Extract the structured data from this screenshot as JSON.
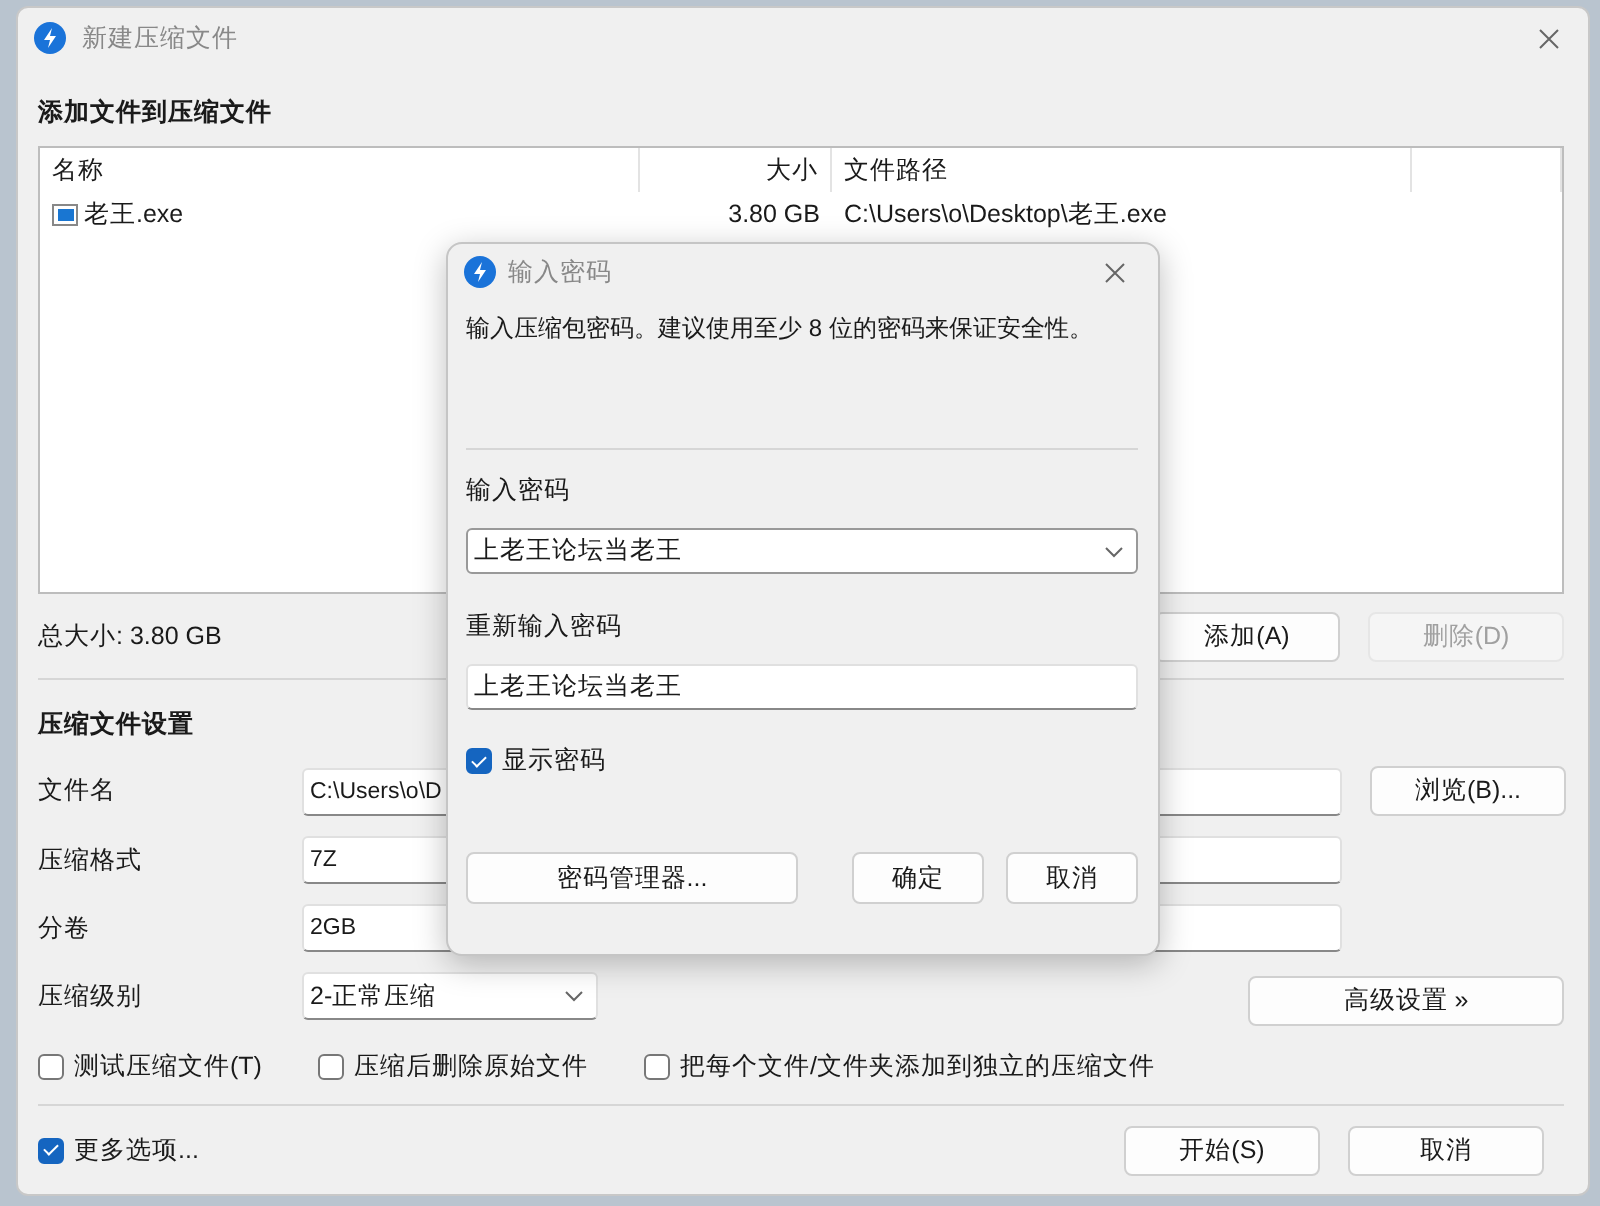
{
  "window": {
    "title": "新建压缩文件"
  },
  "files_section": {
    "heading": "添加文件到压缩文件",
    "columns": [
      "名称",
      "大小",
      "文件路径"
    ],
    "rows": [
      {
        "name": "老王.exe",
        "size": "3.80 GB",
        "path": "C:\\Users\\o\\Desktop\\老王.exe"
      }
    ],
    "total": "总大小: 3.80 GB",
    "buttons": [
      {
        "label": "添加(A)",
        "disabled": false
      },
      {
        "label": "删除(D)",
        "disabled": true
      }
    ]
  },
  "settings": {
    "heading": "压缩文件设置",
    "fields": [
      {
        "label": "文件名",
        "value": "C:\\Users\\o\\D",
        "kind": "text"
      },
      {
        "label": "压缩格式",
        "value": "7Z",
        "kind": "text"
      },
      {
        "label": "分卷",
        "value": "2GB",
        "kind": "text"
      },
      {
        "label": "压缩级别",
        "value": "2-正常压缩",
        "kind": "dropdown"
      }
    ],
    "browse_button": "浏览(B)...",
    "advanced_button": "高级设置 »",
    "options": [
      {
        "label": "测试压缩文件(T)",
        "checked": false
      },
      {
        "label": "压缩后删除原始文件",
        "checked": false
      },
      {
        "label": "把每个文件/文件夹添加到独立的压缩文件",
        "checked": false
      }
    ]
  },
  "more_options": {
    "label": "更多选项...",
    "checked": true
  },
  "buttons": [
    "开始(S)",
    "取消"
  ],
  "password_dialog": {
    "title": "输入密码",
    "message": "输入压缩包密码。建议使用至少 8 位的密码来保证安全性。",
    "password_label": "输入密码",
    "password_value": "上老王论坛当老王",
    "confirm_label": "重新输入密码",
    "confirm_value": "上老王论坛当老王",
    "show_password": {
      "label": "显示密码",
      "checked": true
    },
    "manager_button": "密码管理器...",
    "buttons": [
      "确定",
      "取消"
    ]
  }
}
